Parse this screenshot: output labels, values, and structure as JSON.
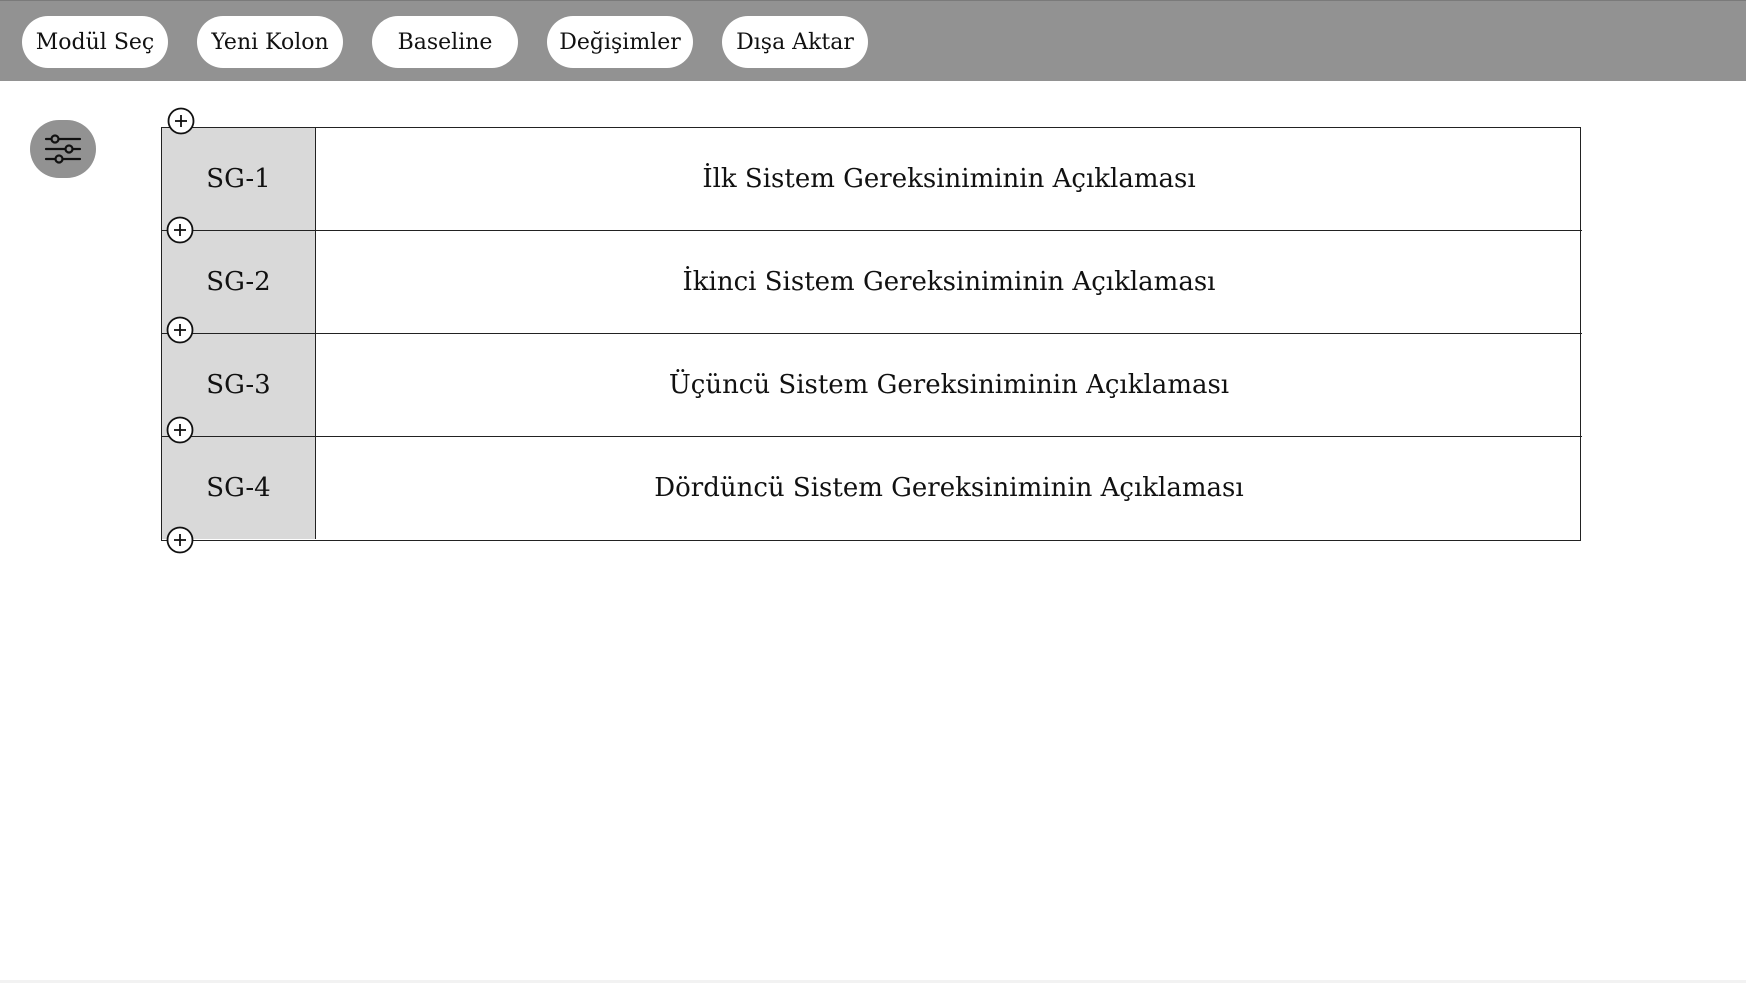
{
  "toolbar": {
    "buttons": [
      {
        "label": "Modül Seç"
      },
      {
        "label": "Yeni Kolon"
      },
      {
        "label": "Baseline"
      },
      {
        "label": "Değişimler"
      },
      {
        "label": "Dışa Aktar"
      }
    ]
  },
  "filter": {
    "icon": "sliders-icon"
  },
  "table": {
    "rows": [
      {
        "id": "SG-1",
        "description": "İlk Sistem Gereksiniminin Açıklaması"
      },
      {
        "id": "SG-2",
        "description": "İkinci Sistem Gereksiniminin Açıklaması"
      },
      {
        "id": "SG-3",
        "description": "Üçüncü Sistem Gereksiniminin Açıklaması"
      },
      {
        "id": "SG-4",
        "description": "Dördüncü Sistem Gereksiniminin Açıklaması"
      }
    ],
    "add_row_icon": "plus-circle-icon"
  },
  "colors": {
    "toolbar_bg": "#929292",
    "id_cell_bg": "#d9d9d9",
    "border": "#222222"
  }
}
